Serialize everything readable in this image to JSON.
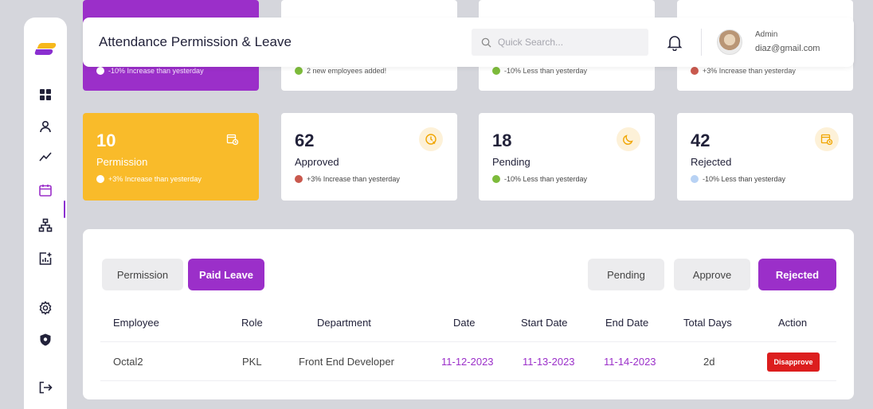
{
  "header": {
    "title": "Attendance Permission & Leave",
    "search_placeholder": "Quick Search...",
    "admin_name": "Admin",
    "admin_email": "diaz@gmail.com"
  },
  "top_cards": [
    {
      "trend": "-10% Increase than yesterday",
      "dot_color": "#ffffff"
    },
    {
      "trend": "2 new employees added!",
      "dot_color": "#7dbb3b"
    },
    {
      "trend": "-10% Less than yesterday",
      "dot_color": "#7dbb3b"
    },
    {
      "trend": "+3% Increase than yesterday",
      "dot_color": "#c9594e"
    }
  ],
  "stat_cards": [
    {
      "number": "10",
      "label": "Permission",
      "trend": "+3% Increase than yesterday",
      "icon": "calendar-clock-icon",
      "dot_color": "#ffffff"
    },
    {
      "number": "62",
      "label": "Approved",
      "trend": "+3% Increase than yesterday",
      "icon": "clock-cancel-icon",
      "dot_color": "#c9594e"
    },
    {
      "number": "18",
      "label": "Pending",
      "trend": "-10% Less than yesterday",
      "icon": "moon-icon",
      "dot_color": "#7dbb3b"
    },
    {
      "number": "42",
      "label": "Rejected",
      "trend": "-10% Less than yesterday",
      "icon": "calendar-clock-icon",
      "dot_color": "#b8d2f4"
    }
  ],
  "tabs": {
    "permission": "Permission",
    "paid_leave": "Paid Leave",
    "pending": "Pending",
    "approve": "Approve",
    "rejected": "Rejected"
  },
  "table": {
    "columns": [
      "Employee",
      "Role",
      "Department",
      "Date",
      "Start Date",
      "End Date",
      "Total Days",
      "Action"
    ],
    "rows": [
      {
        "employee": "Octal2",
        "role": "PKL",
        "department": "Front End Developer",
        "date": "11-12-2023",
        "start_date": "11-13-2023",
        "end_date": "11-14-2023",
        "total_days": "2d",
        "action": "Disapprove"
      }
    ]
  },
  "colors": {
    "accent": "#9b2fc9",
    "warning": "#f9bb2a",
    "danger": "#dc1e1e",
    "background": "#d5d6dc"
  }
}
